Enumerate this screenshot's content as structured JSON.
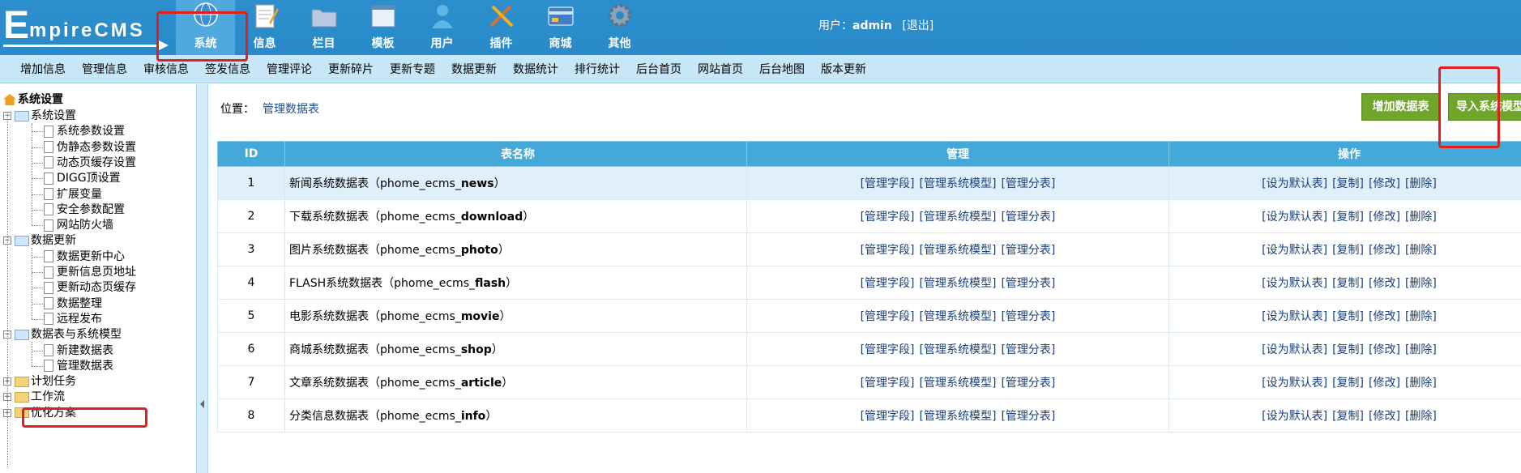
{
  "logo": {
    "first": "E",
    "rest": "mpireCMS"
  },
  "nav": [
    {
      "label": "系统",
      "icon": "globe-icon",
      "active": true
    },
    {
      "label": "信息",
      "icon": "note-icon",
      "active": false
    },
    {
      "label": "栏目",
      "icon": "folder-icon",
      "active": false
    },
    {
      "label": "模板",
      "icon": "window-icon",
      "active": false
    },
    {
      "label": "用户",
      "icon": "user-icon",
      "active": false
    },
    {
      "label": "插件",
      "icon": "tools-icon",
      "active": false
    },
    {
      "label": "商城",
      "icon": "card-icon",
      "active": false
    },
    {
      "label": "其他",
      "icon": "gear-icon",
      "active": false
    }
  ],
  "user": {
    "prefix": "用户：",
    "name": "admin",
    "logout": "[退出]"
  },
  "submenu": [
    "增加信息",
    "管理信息",
    "审核信息",
    "签发信息",
    "管理评论",
    "更新碎片",
    "更新专题",
    "数据更新",
    "数据统计",
    "排行统计",
    "后台首页",
    "网站首页",
    "后台地图",
    "版本更新"
  ],
  "tree": {
    "root": "系统设置",
    "groups": [
      {
        "label": "系统设置",
        "open": true,
        "children": [
          "系统参数设置",
          "伪静态参数设置",
          "动态页缓存设置",
          "DIGG顶设置",
          "扩展变量",
          "安全参数配置",
          "网站防火墙"
        ]
      },
      {
        "label": "数据更新",
        "open": true,
        "children": [
          "数据更新中心",
          "更新信息页地址",
          "更新动态页缓存",
          "数据整理",
          "远程发布"
        ]
      },
      {
        "label": "数据表与系统模型",
        "open": true,
        "children": [
          "新建数据表",
          "管理数据表"
        ]
      },
      {
        "label": "计划任务",
        "open": false,
        "children": []
      },
      {
        "label": "工作流",
        "open": false,
        "children": []
      },
      {
        "label": "优化方案",
        "open": false,
        "children": []
      }
    ]
  },
  "location": {
    "label": "位置：",
    "current": "管理数据表"
  },
  "buttons": {
    "add": "增加数据表",
    "import": "导入系统模型"
  },
  "table": {
    "headers": [
      "ID",
      "表名称",
      "管理",
      "操作"
    ],
    "manage_links": [
      "[管理字段]",
      "[管理系统模型]",
      "[管理分表]"
    ],
    "op_links": [
      "[设为默认表]",
      "[复制]",
      "[修改]",
      "[删除]"
    ],
    "rows": [
      {
        "id": "1",
        "name": "新闻系统数据表",
        "prefix": "phome_ecms_",
        "table": "news"
      },
      {
        "id": "2",
        "name": "下载系统数据表",
        "prefix": "phome_ecms_",
        "table": "download"
      },
      {
        "id": "3",
        "name": "图片系统数据表",
        "prefix": "phome_ecms_",
        "table": "photo"
      },
      {
        "id": "4",
        "name": "FLASH系统数据表",
        "prefix": "phome_ecms_",
        "table": "flash"
      },
      {
        "id": "5",
        "name": "电影系统数据表",
        "prefix": "phome_ecms_",
        "table": "movie"
      },
      {
        "id": "6",
        "name": "商城系统数据表",
        "prefix": "phome_ecms_",
        "table": "shop"
      },
      {
        "id": "7",
        "name": "文章系统数据表",
        "prefix": "phome_ecms_",
        "table": "article"
      },
      {
        "id": "8",
        "name": "分类信息数据表",
        "prefix": "phome_ecms_",
        "table": "info"
      }
    ]
  }
}
